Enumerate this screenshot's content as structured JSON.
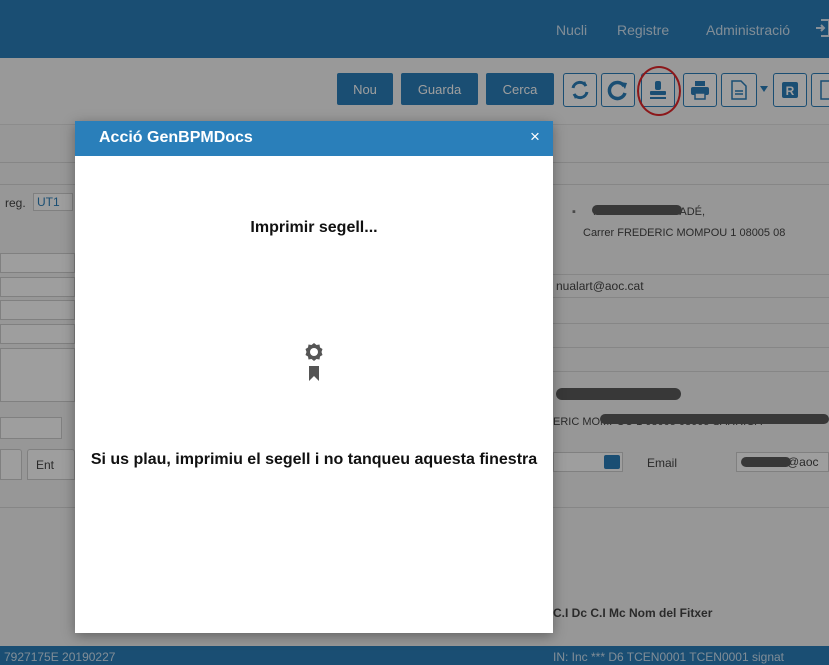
{
  "nav": {
    "items": [
      "Nucli",
      "Registre",
      "Administració"
    ]
  },
  "toolbar": {
    "new_label": "Nou",
    "save_label": "Guarda",
    "search_label": "Cerca",
    "icons": [
      "refresh-double-icon",
      "reload-icon",
      "stamp-icon",
      "print-icon",
      "document-icon",
      "report-icon",
      "document-icon"
    ]
  },
  "background": {
    "reg_label": "reg.",
    "reg_value": "UT1",
    "contact_name": "NUALART MERCADÉ,",
    "contact_address": "Carrer FREDERIC MOMPOU 1 08005 08",
    "email_value": "nualart@aoc.cat",
    "street_text": "ERIC MOMPOU 1 08005 08005 SARRIGA",
    "email_label": "Email",
    "email_value_2": "@aoc",
    "tab_label": "Ent",
    "table_header": "C.I Dc C.I Mc Nom del Fitxer",
    "footer_left": "7927175E 20190227",
    "footer_right": "IN: Inc *** D6 TCEN0001 TCEN0001 signat"
  },
  "modal": {
    "title": "Acció GenBPMDocs",
    "close": "×",
    "heading": "Imprimir segell...",
    "message": "Si us plau, imprimiu el segell i no tanqueu aquesta finestra"
  },
  "colors": {
    "primary": "#2a7fba",
    "highlight_circle": "#e2262a"
  }
}
